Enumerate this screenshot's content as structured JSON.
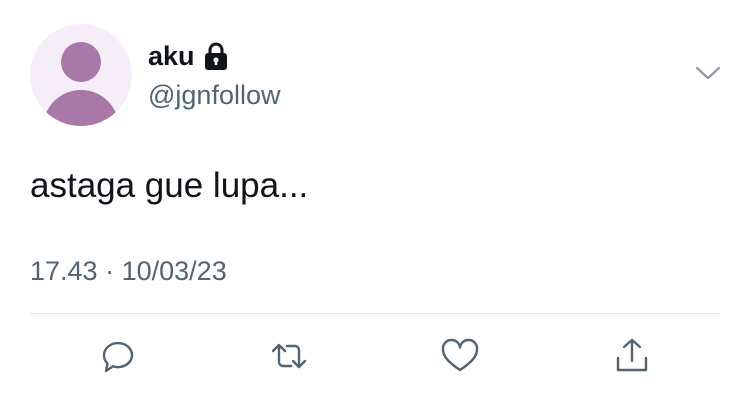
{
  "tweet": {
    "author": {
      "display_name": "aku",
      "handle": "@jgnfollow",
      "protected": true
    },
    "text": "astaga gue lupa...",
    "time": "17.43",
    "separator": "·",
    "date": "10/03/23"
  },
  "icons": {
    "avatar": "default-avatar",
    "protected": "lock-icon",
    "more": "chevron-down-icon",
    "reply": "reply-icon",
    "retweet": "retweet-icon",
    "like": "heart-icon",
    "share": "share-icon"
  },
  "colors": {
    "text": "#0f1419",
    "secondary_text": "#536471",
    "avatar_bg": "#f5eef8",
    "avatar_figure": "#a878a8",
    "divider": "#e1e5e8",
    "icon": "#536471"
  }
}
